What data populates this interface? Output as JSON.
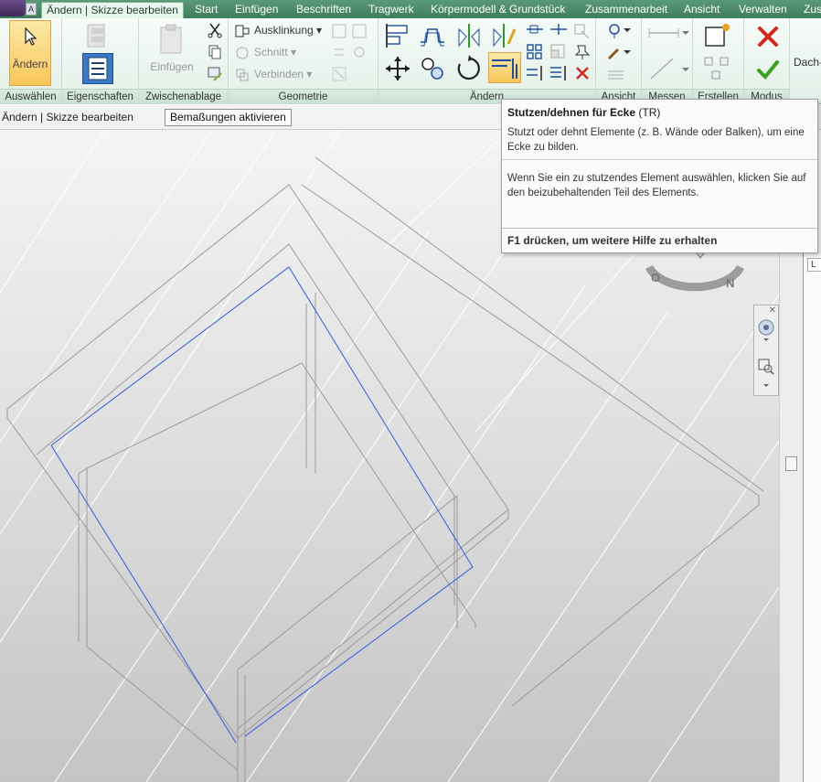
{
  "tabs": [
    "Ändern | Skizze bearbeiten",
    "Start",
    "Einfügen",
    "Beschriften",
    "Tragwerk",
    "Körpermodell & Grundstück",
    "Zusammenarbeit",
    "Ansicht",
    "Verwalten",
    "Zus"
  ],
  "app_badge": "A",
  "ribbon": {
    "panels": {
      "select": "Auswählen",
      "properties": "Eigenschaften",
      "clipboard": "Zwischenablage",
      "geometry": "Geometrie",
      "modify": "Ändern",
      "view": "Ansicht",
      "measure": "Messen",
      "create": "Erstellen",
      "mode": "Modus"
    },
    "modify_button": "Ändern",
    "paste_button": "Einfügen",
    "geometry_items": [
      "Ausklinkung",
      "Schnitt",
      "Verbinden"
    ],
    "dach_label": "Dach-"
  },
  "options_bar": {
    "context": "Ändern | Skizze bearbeiten",
    "activate_dimensions": "Bemaßungen aktivieren"
  },
  "tooltip": {
    "title": "Stutzen/dehnen für Ecke",
    "shortcut": "(TR)",
    "description": "Stutzt oder dehnt Elemente (z. B. Wände oder Balken), um eine Ecke zu bilden.",
    "detail": "Wenn Sie ein zu stutzendes Element auswählen, klicken Sie auf den beizubehaltenden Teil des Elements.",
    "help": "F1 drücken, um weitere Hilfe zu erhalten"
  },
  "viewcube": {
    "south": "O",
    "north": "N"
  },
  "right_panel": {
    "tab": "L"
  },
  "colors": {
    "tabbar": "#3f7e5d",
    "sketch_line": "#2b5ce6",
    "cancel": "#d9261c",
    "finish": "#3aa01f"
  },
  "icons": [
    "modify-cursor-icon",
    "properties-icon",
    "paste-icon",
    "cut-icon",
    "copy-icon",
    "match-icon",
    "cope-icon",
    "cut-geometry-icon",
    "join-icon",
    "align-icon",
    "offset-icon",
    "mirror-axis-icon",
    "mirror-draw-icon",
    "move-icon",
    "copy-elements-icon",
    "rotate-icon",
    "trim-extend-corner-icon",
    "split-icon",
    "array-icon",
    "scale-icon",
    "pin-icon",
    "delete-icon",
    "hide-icon",
    "paint-icon",
    "measure-icon",
    "create-similar-icon",
    "cancel-icon",
    "finish-icon"
  ]
}
